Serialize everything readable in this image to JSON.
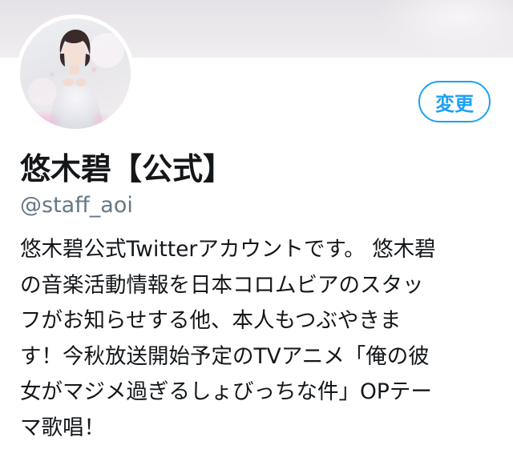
{
  "profile": {
    "display_name": "悠木碧【公式】",
    "handle": "@staff_aoi",
    "edit_button_label": "変更",
    "bio_lines": [
      "悠木碧公式Twitterアカウントです。 悠木碧",
      "の音楽活動情報を日本コロムビアのスタッ",
      "フがお知らせする他、本人もつぶやきま",
      "す！今秋放送開始予定のTVアニメ「俺の彼",
      "女がマジメ過ぎるしょびっちな件」OPテー",
      "マ歌唱！"
    ]
  },
  "colors": {
    "accent": "#1da1f2",
    "text_primary": "#14171a",
    "text_secondary": "#657786"
  },
  "icons": {
    "avatar": "profile-photo"
  }
}
